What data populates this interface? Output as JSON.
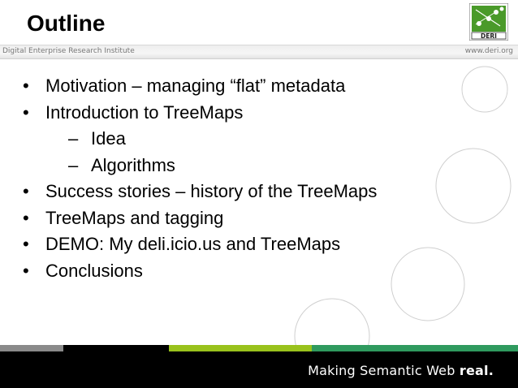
{
  "slide": {
    "title": "Outline",
    "institute": "Digital Enterprise Research Institute",
    "site": "www.deri.org",
    "logo_text": "DERI",
    "bullets": [
      "Motivation – managing “flat” metadata",
      "Introduction to TreeMaps",
      "Success stories – history of the TreeMaps",
      "TreeMaps and tagging",
      "DEMO: My deli.icio.us and TreeMaps",
      "Conclusions"
    ],
    "sub_bullets": [
      "Idea",
      "Algorithms"
    ],
    "bullet_symbol": "•",
    "sub_bullet_symbol": "–",
    "footer": {
      "slogan": "Making Semantic Web",
      "slogan_strong": "real."
    },
    "colors": {
      "footer_gray": "#8a8a8a",
      "footer_black": "#000000",
      "footer_lime": "#99c21c",
      "footer_green": "#2f9a5e",
      "logo_green": "#4a9a2a"
    }
  }
}
